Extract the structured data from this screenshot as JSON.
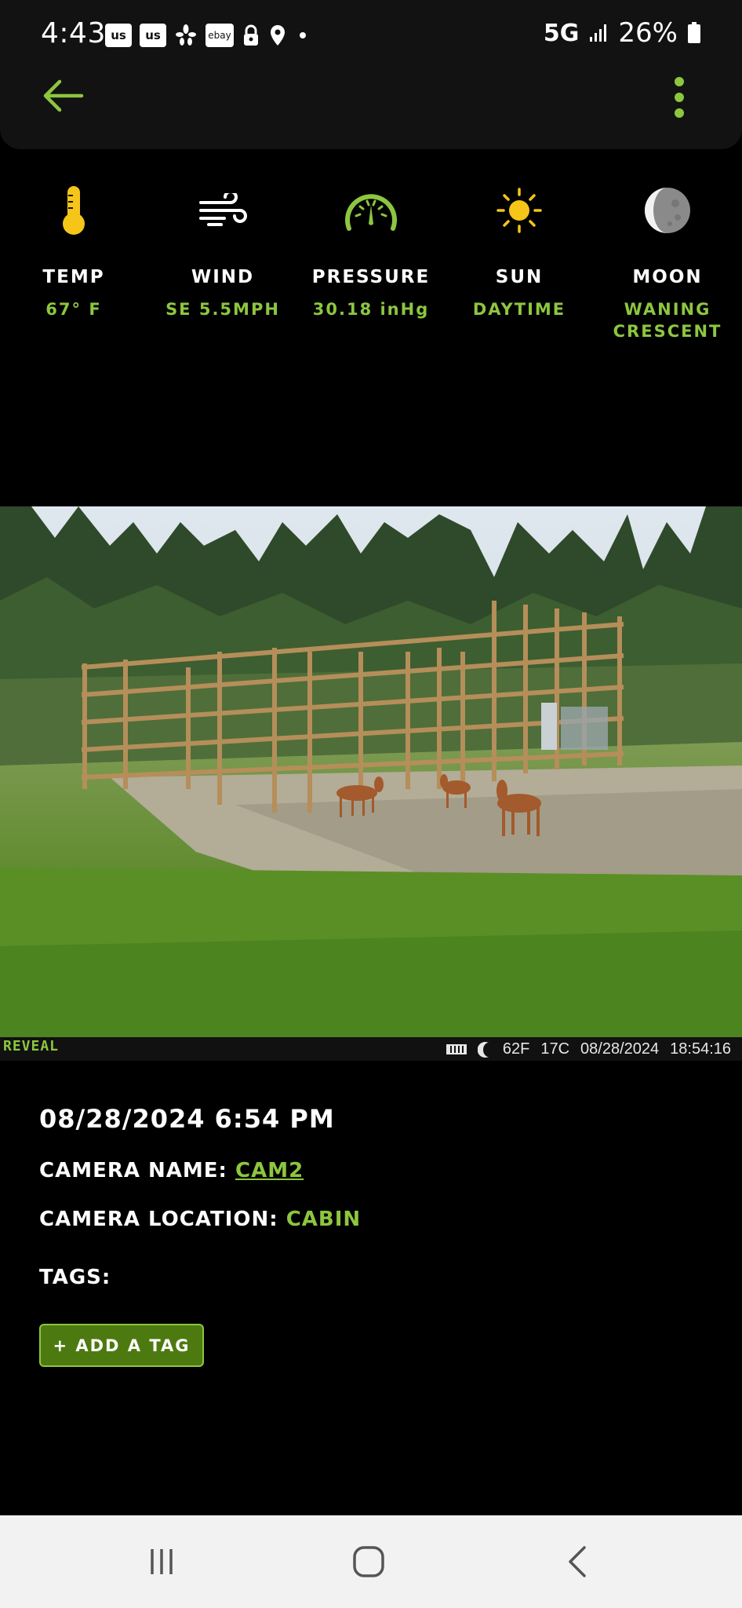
{
  "status_bar": {
    "time": "4:43",
    "notif_icons": [
      "us",
      "us",
      "yelp-icon",
      "ebay",
      "lock-icon",
      "location-icon"
    ],
    "network": "5G",
    "battery": "26%"
  },
  "app_bar": {
    "back_icon": "arrow-left-icon",
    "menu_icon": "more-vertical-icon"
  },
  "weather": [
    {
      "label": "TEMP",
      "value": "67° F",
      "icon": "thermometer-icon"
    },
    {
      "label": "WIND",
      "value": "SE 5.5MPH",
      "icon": "wind-icon"
    },
    {
      "label": "PRESSURE",
      "value": "30.18 inHg",
      "icon": "gauge-icon"
    },
    {
      "label": "SUN",
      "value": "DAYTIME",
      "icon": "sun-icon"
    },
    {
      "label": "MOON",
      "value": "WANING CRESCENT",
      "icon": "moon-icon"
    }
  ],
  "photo": {
    "brand": "REVEAL",
    "stamp_temp_f": "62F",
    "stamp_temp_c": "17C",
    "stamp_date": "08/28/2024",
    "stamp_time": "18:54:16"
  },
  "details": {
    "datetime": "08/28/2024 6:54 PM",
    "camera_name_label": "CAMERA NAME:",
    "camera_name": "CAM2",
    "camera_location_label": "CAMERA LOCATION:",
    "camera_location": "CABIN",
    "tags_label": "TAGS:",
    "add_tag_label": "+ ADD A TAG"
  },
  "colors": {
    "accent": "#8dc63f",
    "button": "#4d7a10",
    "sun": "#f5c518"
  },
  "nav_bar": [
    "recents-icon",
    "home-icon",
    "back-icon"
  ]
}
